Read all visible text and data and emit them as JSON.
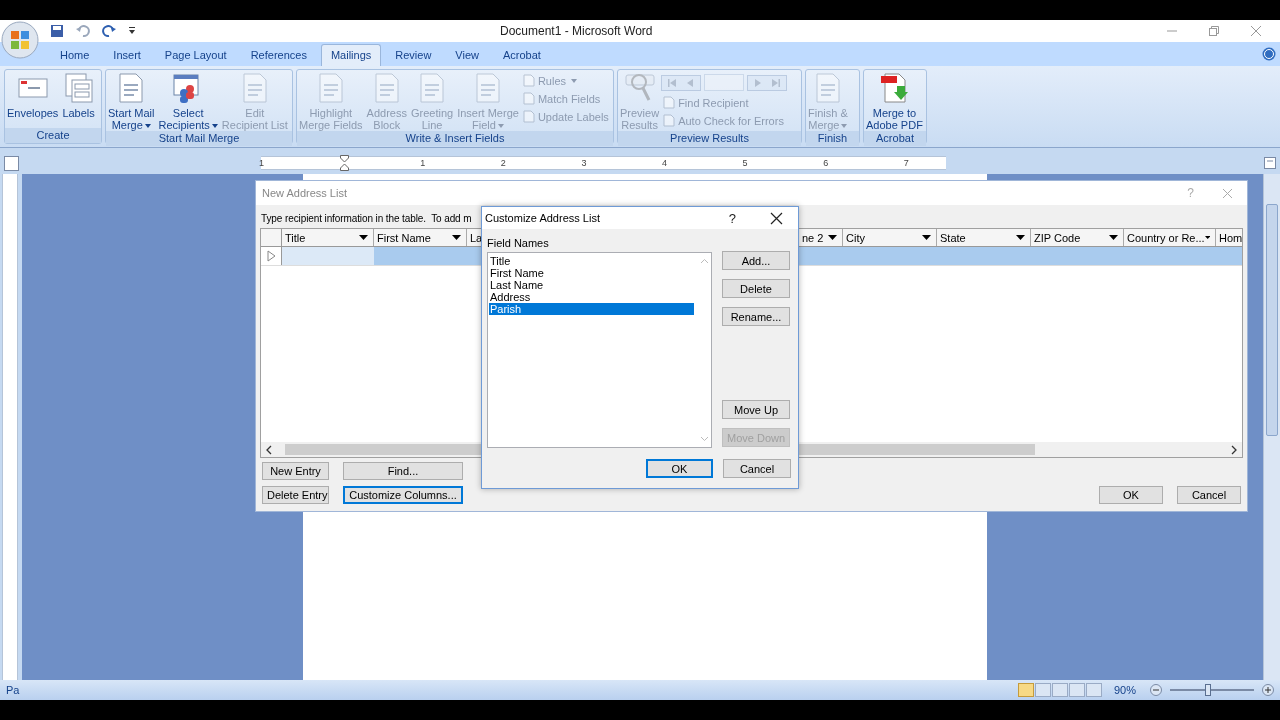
{
  "window": {
    "title": "Document1 - Microsoft Word"
  },
  "tabs": [
    {
      "label": "Home",
      "selected": false
    },
    {
      "label": "Insert",
      "selected": false
    },
    {
      "label": "Page Layout",
      "selected": false
    },
    {
      "label": "References",
      "selected": false
    },
    {
      "label": "Mailings",
      "selected": true
    },
    {
      "label": "Review",
      "selected": false
    },
    {
      "label": "View",
      "selected": false
    },
    {
      "label": "Acrobat",
      "selected": false
    }
  ],
  "ribbon": [
    {
      "label": "Create",
      "items": [
        {
          "kind": "large",
          "label": "Envelopes",
          "disabled": false,
          "dropdown": false
        },
        {
          "kind": "large",
          "label": "Labels",
          "disabled": false,
          "dropdown": false
        }
      ]
    },
    {
      "label": "Start Mail Merge",
      "items": [
        {
          "kind": "large",
          "label": "Start Mail\nMerge",
          "disabled": false,
          "dropdown": true
        },
        {
          "kind": "large",
          "label": "Select\nRecipients",
          "disabled": false,
          "dropdown": true
        },
        {
          "kind": "large",
          "label": "Edit\nRecipient List",
          "disabled": true,
          "dropdown": false
        }
      ]
    },
    {
      "label": "Write & Insert Fields",
      "items": [
        {
          "kind": "large",
          "label": "Highlight\nMerge Fields",
          "disabled": true,
          "dropdown": false
        },
        {
          "kind": "large",
          "label": "Address\nBlock",
          "disabled": true,
          "dropdown": false
        },
        {
          "kind": "large",
          "label": "Greeting\nLine",
          "disabled": true,
          "dropdown": false
        },
        {
          "kind": "large",
          "label": "Insert Merge\nField",
          "disabled": true,
          "dropdown": true
        },
        {
          "kind": "small",
          "label": "Rules",
          "disabled": true,
          "dropdown": true
        },
        {
          "kind": "small",
          "label": "Match Fields",
          "disabled": true,
          "dropdown": false
        },
        {
          "kind": "small",
          "label": "Update Labels",
          "disabled": true,
          "dropdown": false
        }
      ]
    },
    {
      "label": "Preview Results",
      "items": [
        {
          "kind": "large",
          "label": "Preview\nResults",
          "disabled": true,
          "dropdown": false
        },
        {
          "kind": "nav",
          "disabled": true
        },
        {
          "kind": "small",
          "label": "Find Recipient",
          "disabled": true,
          "dropdown": false
        },
        {
          "kind": "small",
          "label": "Auto Check for Errors",
          "disabled": true,
          "dropdown": false
        }
      ]
    },
    {
      "label": "Finish",
      "items": [
        {
          "kind": "large",
          "label": "Finish &\nMerge",
          "disabled": true,
          "dropdown": true
        }
      ]
    },
    {
      "label": "Acrobat",
      "items": [
        {
          "kind": "large",
          "label": "Merge to\nAdobe PDF",
          "disabled": false,
          "dropdown": false
        }
      ]
    }
  ],
  "ruler": {
    "labels": [
      "1",
      "1",
      "2",
      "3",
      "4",
      "5",
      "6",
      "7"
    ]
  },
  "new_address_list": {
    "title": "New Address List",
    "instruction": "Type recipient information in the table.  To add m",
    "columns": [
      {
        "label": "Title"
      },
      {
        "label": "First Name"
      },
      {
        "label": "La"
      },
      {
        "label": "ne 2"
      },
      {
        "label": "City"
      },
      {
        "label": "State"
      },
      {
        "label": "ZIP Code"
      },
      {
        "label": "Country or Re..."
      },
      {
        "label": "Hom"
      }
    ],
    "rows": [
      {
        "selected": true
      }
    ],
    "buttons": [
      {
        "label": "New Entry",
        "focused": false
      },
      {
        "label": "Find...",
        "focused": false
      },
      {
        "label": "Delete Entry",
        "focused": false
      },
      {
        "label": "Customize Columns...",
        "focused": true
      }
    ],
    "ok": "OK",
    "cancel": "Cancel",
    "help": "?"
  },
  "customize_dialog": {
    "title": "Customize Address List",
    "help": "?",
    "list_label": "Field Names",
    "fields": [
      {
        "label": "Title",
        "selected": false
      },
      {
        "label": "First Name",
        "selected": false
      },
      {
        "label": "Last Name",
        "selected": false
      },
      {
        "label": "Address",
        "selected": false
      },
      {
        "label": "Parish",
        "selected": true
      }
    ],
    "side_buttons": [
      {
        "label": "Add...",
        "disabled": false
      },
      {
        "label": "Delete",
        "disabled": false
      },
      {
        "label": "Rename...",
        "disabled": false
      },
      {
        "label": "Move Up",
        "disabled": false
      },
      {
        "label": "Move Down",
        "disabled": true
      }
    ],
    "ok": "OK",
    "cancel": "Cancel"
  },
  "status_bar": {
    "page": "Pa",
    "zoom": "90%",
    "zoom_slider": {
      "level": 0.45
    }
  }
}
